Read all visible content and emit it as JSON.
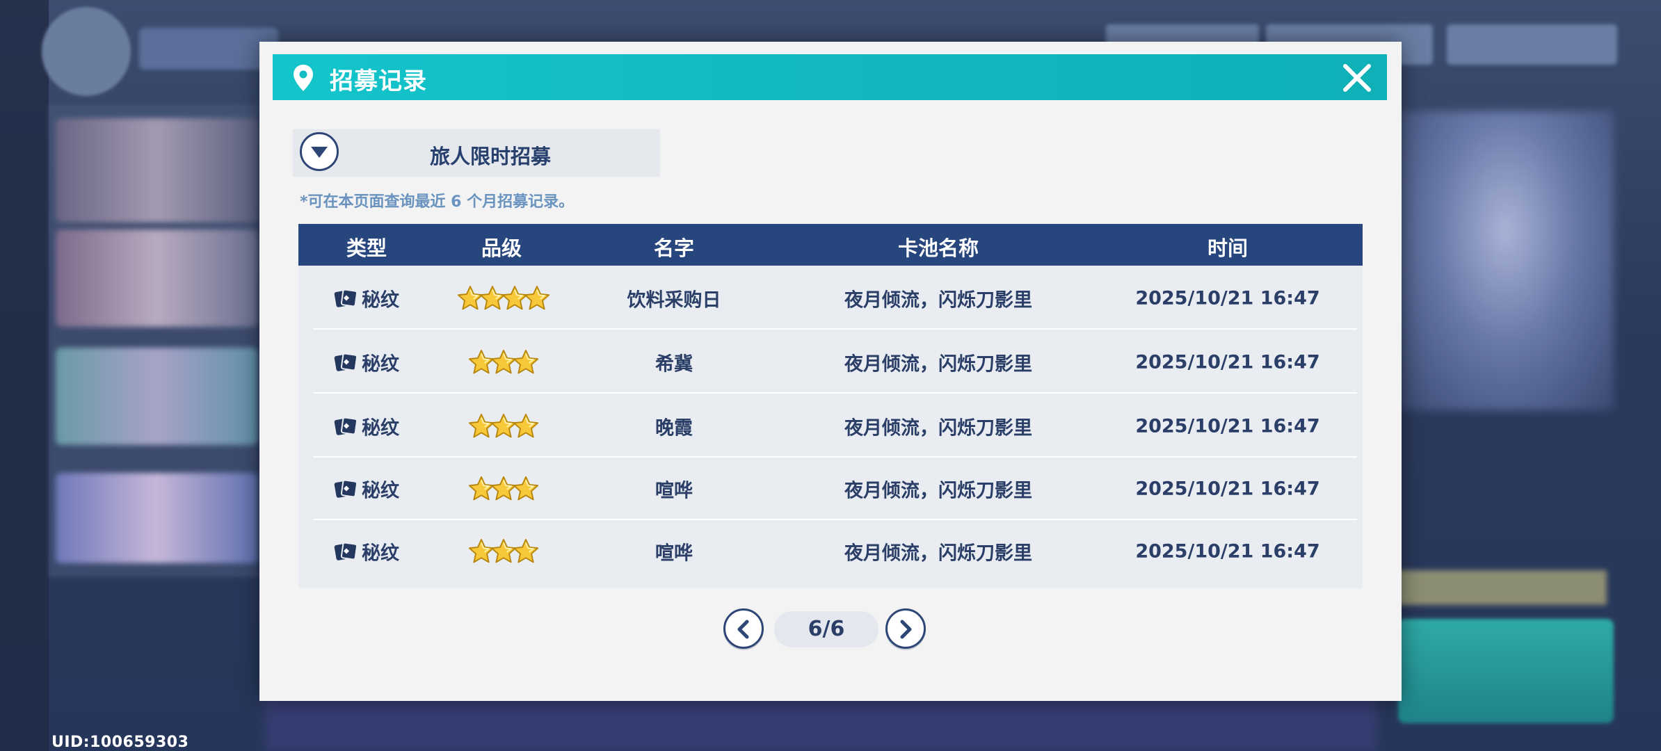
{
  "uid": "UID:100659303",
  "modal": {
    "title": "招募记录",
    "pool_selector": "旅人限时招募",
    "note": "*可在本页面查询最近 6 个月招募记录。"
  },
  "table": {
    "headers": [
      "类型",
      "品级",
      "名字",
      "卡池名称",
      "时间"
    ],
    "rows": [
      {
        "type": "秘纹",
        "stars": 4,
        "name": "饮料采购日",
        "pool": "夜月倾流，闪烁刀影里",
        "time": "2025/10/21 16:47"
      },
      {
        "type": "秘纹",
        "stars": 3,
        "name": "希冀",
        "pool": "夜月倾流，闪烁刀影里",
        "time": "2025/10/21 16:47"
      },
      {
        "type": "秘纹",
        "stars": 3,
        "name": "晚霞",
        "pool": "夜月倾流，闪烁刀影里",
        "time": "2025/10/21 16:47"
      },
      {
        "type": "秘纹",
        "stars": 3,
        "name": "喧哗",
        "pool": "夜月倾流，闪烁刀影里",
        "time": "2025/10/21 16:47"
      },
      {
        "type": "秘纹",
        "stars": 3,
        "name": "喧哗",
        "pool": "夜月倾流，闪烁刀影里",
        "time": "2025/10/21 16:47"
      }
    ]
  },
  "pagination": {
    "current": "6/6"
  },
  "icons": {
    "pin": "location-pin-icon",
    "close": "close-icon",
    "dropdown": "chevron-down-icon",
    "type": "card-sigil-icon",
    "star": "gold-star-icon",
    "prev": "chevron-left-icon",
    "next": "chevron-right-icon"
  },
  "colors": {
    "header_teal": "#13c5cb",
    "table_header": "#28467e",
    "text_dark": "#2a3e68",
    "note_blue": "#6a93bf",
    "star_gold": "#f5c22c"
  }
}
